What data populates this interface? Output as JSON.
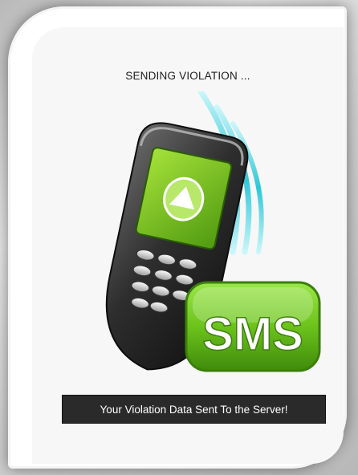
{
  "screen": {
    "status_title": "SENDING VIOLATION ...",
    "toast_message": "Your Violation Data Sent To the Server!"
  },
  "illustration": {
    "badge_text": "SMS",
    "icons": [
      "phone-icon",
      "signal-waves-icon",
      "upload-arrow-icon",
      "sms-badge-icon"
    ],
    "colors": {
      "phone_body": "#3a3a3a",
      "phone_screen": "#7fc41a",
      "waves": "#2ec7d6",
      "badge_green": "#6cc31b"
    }
  }
}
